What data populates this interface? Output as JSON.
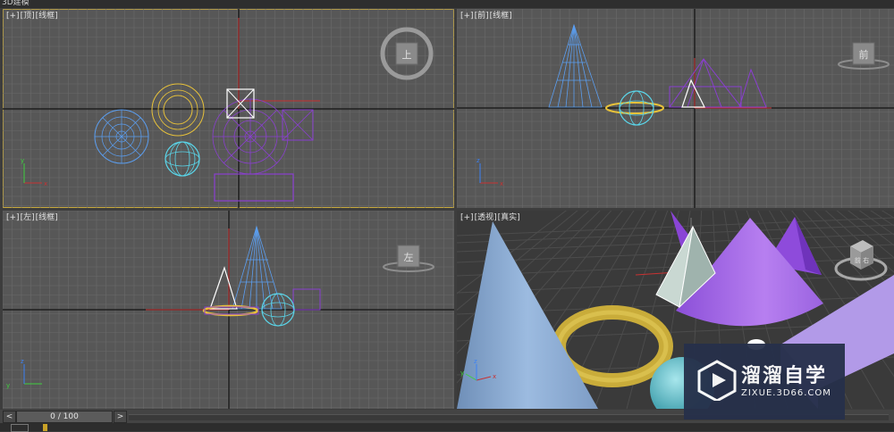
{
  "app": {
    "title": "3D建模"
  },
  "viewports": {
    "top": {
      "plus": "[+]",
      "name": "[顶]",
      "mode": "[线框]",
      "cube": "上"
    },
    "front": {
      "plus": "[+]",
      "name": "[前]",
      "mode": "[线框]",
      "cube": "前"
    },
    "left": {
      "plus": "[+]",
      "name": "[左]",
      "mode": "[线框]",
      "cube": "左"
    },
    "perspective": {
      "plus": "[+]",
      "name": "[透视]",
      "mode": "[真实]",
      "cube": "前 右"
    }
  },
  "timeline": {
    "prev": "<",
    "frame": "0 / 100",
    "next": ">"
  },
  "colors": {
    "grid": "#6b6b6b",
    "wire_blue": "#5b9ef0",
    "wire_yellow": "#e8c23a",
    "wire_cyan": "#5ad6ea",
    "wire_purple": "#8a3fd0",
    "active_border": "#c7a93c"
  },
  "watermark": {
    "title": "溜溜自学",
    "subtitle": "ZIXUE.3D66.COM"
  },
  "axis_labels": {
    "x": "x",
    "y": "y",
    "z": "z"
  }
}
